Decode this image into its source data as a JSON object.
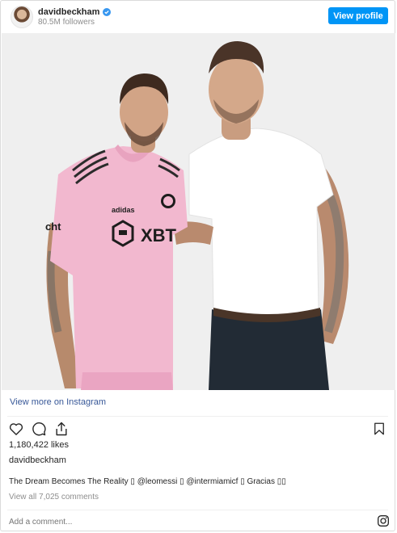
{
  "header": {
    "username": "davidbeckham",
    "followers": "80.5M followers",
    "view_profile_label": "View profile"
  },
  "photo": {
    "jersey_sponsor": "XBT",
    "jersey_brand": "adidas",
    "sleeve_text": "cht"
  },
  "post": {
    "view_more_label": "View more on Instagram",
    "likes": "1,180,422 likes",
    "owner": "davidbeckham",
    "caption": "The Dream Becomes The Reality ▯ @leomessi ▯ @intermiamicf ▯ Gracias ▯▯",
    "comments_label": "View all 7,025 comments",
    "comment_placeholder": "Add a comment..."
  },
  "icons": [
    "verified-icon",
    "heart-icon",
    "comment-icon",
    "share-icon",
    "bookmark-icon",
    "instagram-icon"
  ],
  "colors": {
    "accent": "#0095f6",
    "link": "#385898",
    "muted": "#8e8e8e",
    "jersey": "#f2b8cf"
  }
}
